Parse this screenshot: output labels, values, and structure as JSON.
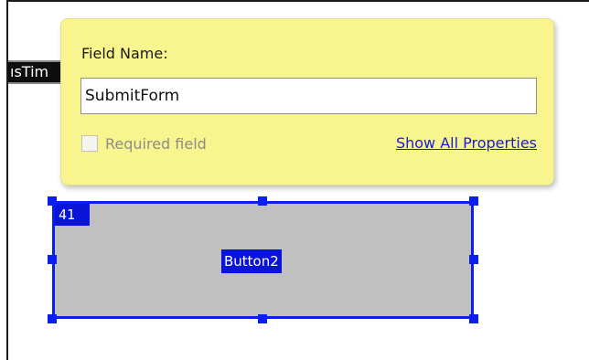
{
  "background_field": {
    "text": "ısTim"
  },
  "popup": {
    "field_label": "Field Name:",
    "field_value": "SubmitForm",
    "required_label": "Required field",
    "required_checked": false,
    "show_all_label": "Show All Properties"
  },
  "button_widget": {
    "tab_order": "41",
    "label": "Button2",
    "selected": true
  },
  "colors": {
    "popup_background": "#f8f58f",
    "selection_blue": "#0a1ef0",
    "widget_fill": "#c0c0c0",
    "link_color": "#1a1ad8"
  },
  "icons": {
    "selection_handles": "resize-handle-icon"
  }
}
